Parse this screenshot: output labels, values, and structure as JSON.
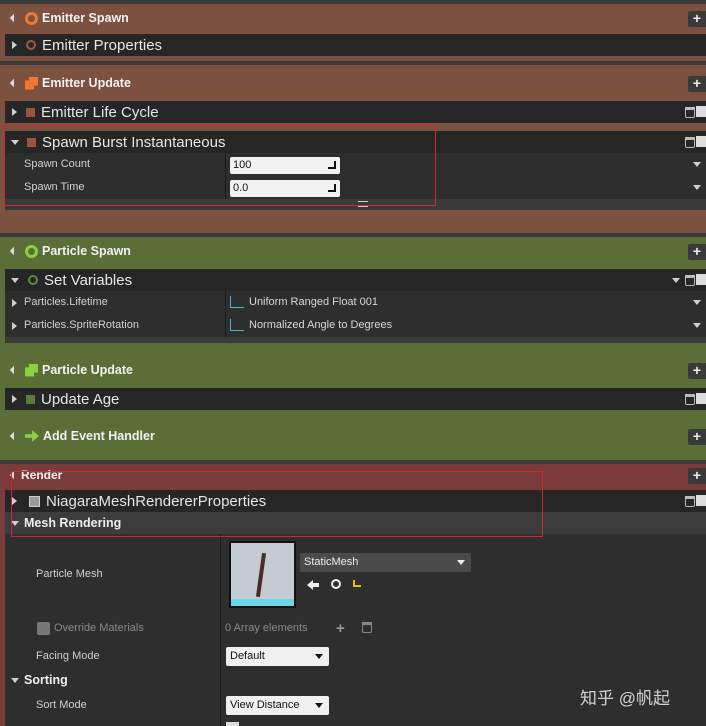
{
  "emitter_spawn": {
    "title": "Emitter Spawn",
    "module": "Emitter Properties"
  },
  "emitter_update": {
    "title": "Emitter Update",
    "module1": "Emitter Life Cycle",
    "module2": "Spawn Burst Instantaneous",
    "props": [
      {
        "label": "Spawn Count",
        "value": "100"
      },
      {
        "label": "Spawn Time",
        "value": "0.0"
      }
    ]
  },
  "particle_spawn": {
    "title": "Particle Spawn",
    "module": "Set Variables",
    "props": [
      {
        "label": "Particles.Lifetime",
        "value": "Uniform Ranged Float 001"
      },
      {
        "label": "Particles.SpriteRotation",
        "value": "Normalized Angle to Degrees"
      }
    ]
  },
  "particle_update": {
    "title": "Particle Update",
    "module": "Update Age"
  },
  "event_handler": {
    "title": "Add Event Handler"
  },
  "render": {
    "title": "Render",
    "module": "NiagaraMeshRendererProperties",
    "category": "Mesh Rendering",
    "particle_mesh_label": "Particle Mesh",
    "mesh_value": "StaticMesh",
    "override_label": "Override Materials",
    "array_text": "0 Array elements",
    "facing_label": "Facing Mode",
    "facing_value": "Default",
    "sorting_label": "Sorting",
    "sort_mode_label": "Sort Mode",
    "sort_mode_value": "View Distance"
  },
  "watermark": "知乎 @帆起",
  "colors": {
    "emitter": "#7a4f3e",
    "particle": "#5a6e3a",
    "render": "#7a3b3b",
    "highlight": "#d0282f"
  }
}
